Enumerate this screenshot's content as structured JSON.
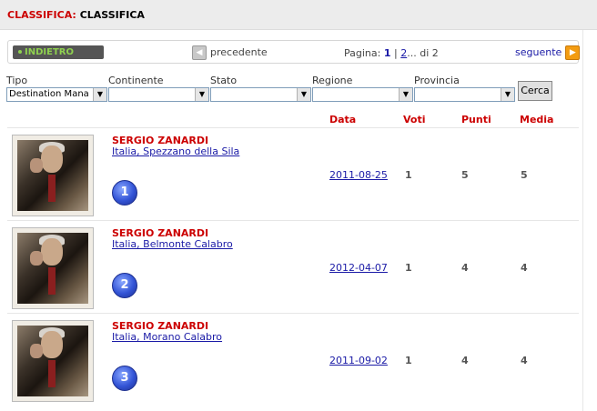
{
  "header": {
    "prefix": "CLASSIFICA:",
    "title": "CLASSIFICA"
  },
  "nav": {
    "back_label": "INDIETRO",
    "prev_label": "precedente",
    "pager_prefix": "Pagina:",
    "current_page": "1",
    "separator": "|",
    "next_page": "2",
    "pager_suffix": "... di 2",
    "next_label": "seguente"
  },
  "filters": [
    {
      "label": "Tipo",
      "value": "Destination Mana"
    },
    {
      "label": "Continente",
      "value": ""
    },
    {
      "label": "Stato",
      "value": ""
    },
    {
      "label": "Regione",
      "value": ""
    },
    {
      "label": "Provincia",
      "value": ""
    }
  ],
  "search_label": "Cerca",
  "columns": {
    "date": "Data",
    "votes": "Voti",
    "points": "Punti",
    "average": "Media"
  },
  "rows": [
    {
      "name": "SERGIO ZANARDI",
      "location": "Italia, Spezzano della Sila",
      "rank": "1",
      "date": "2011-08-25",
      "votes": "1",
      "points": "5",
      "average": "5"
    },
    {
      "name": "SERGIO ZANARDI",
      "location": "Italia, Belmonte Calabro",
      "rank": "2",
      "date": "2012-04-07",
      "votes": "1",
      "points": "4",
      "average": "4"
    },
    {
      "name": "SERGIO ZANARDI",
      "location": "Italia, Morano Calabro",
      "rank": "3",
      "date": "2011-09-02",
      "votes": "1",
      "points": "4",
      "average": "4"
    }
  ]
}
